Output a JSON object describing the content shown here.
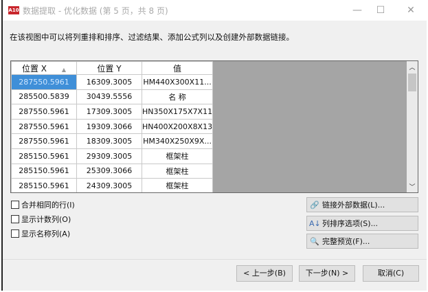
{
  "window": {
    "logo": "A10",
    "title": "数据提取 - 优化数据 (第 5 页，共 8 页)",
    "minimize": "—",
    "maximize": "☐",
    "close": "✕"
  },
  "description": "在该视图中可以将列重排和排序、过滤结果、添加公式列以及创建外部数据链接。",
  "table": {
    "headers": [
      "位置 X",
      "位置 Y",
      "值"
    ],
    "sort_indicator": "▲",
    "rows": [
      [
        "287550.5961",
        "16309.3005",
        "HM440X300X11..."
      ],
      [
        "285500.5839",
        "30439.5556",
        "名 称"
      ],
      [
        "287550.5961",
        "17309.3005",
        "HN350X175X7X11"
      ],
      [
        "287550.5961",
        "19309.3066",
        "HN400X200X8X13"
      ],
      [
        "287550.5961",
        "18309.3005",
        "HM340X250X9X..."
      ],
      [
        "285150.5961",
        "29309.3005",
        "框架柱"
      ],
      [
        "285150.5961",
        "25309.3066",
        "框架柱"
      ],
      [
        "285150.5961",
        "24309.3005",
        "框架柱"
      ]
    ]
  },
  "checkboxes": [
    {
      "label": "合并相同的行(I)",
      "checked": false
    },
    {
      "label": "显示计数列(O)",
      "checked": false
    },
    {
      "label": "显示名称列(A)",
      "checked": false
    }
  ],
  "actions": [
    {
      "icon": "link-icon",
      "glyph": "🔗",
      "label": "链接外部数据(L)..."
    },
    {
      "icon": "sort-az-icon",
      "glyph": "A↓",
      "label": "列排序选项(S)..."
    },
    {
      "icon": "preview-icon",
      "glyph": "🔍",
      "label": "完整预览(F)..."
    }
  ],
  "footer": {
    "back": "< 上一步(B)",
    "next": "下一步(N) >",
    "cancel": "取消(C)"
  }
}
